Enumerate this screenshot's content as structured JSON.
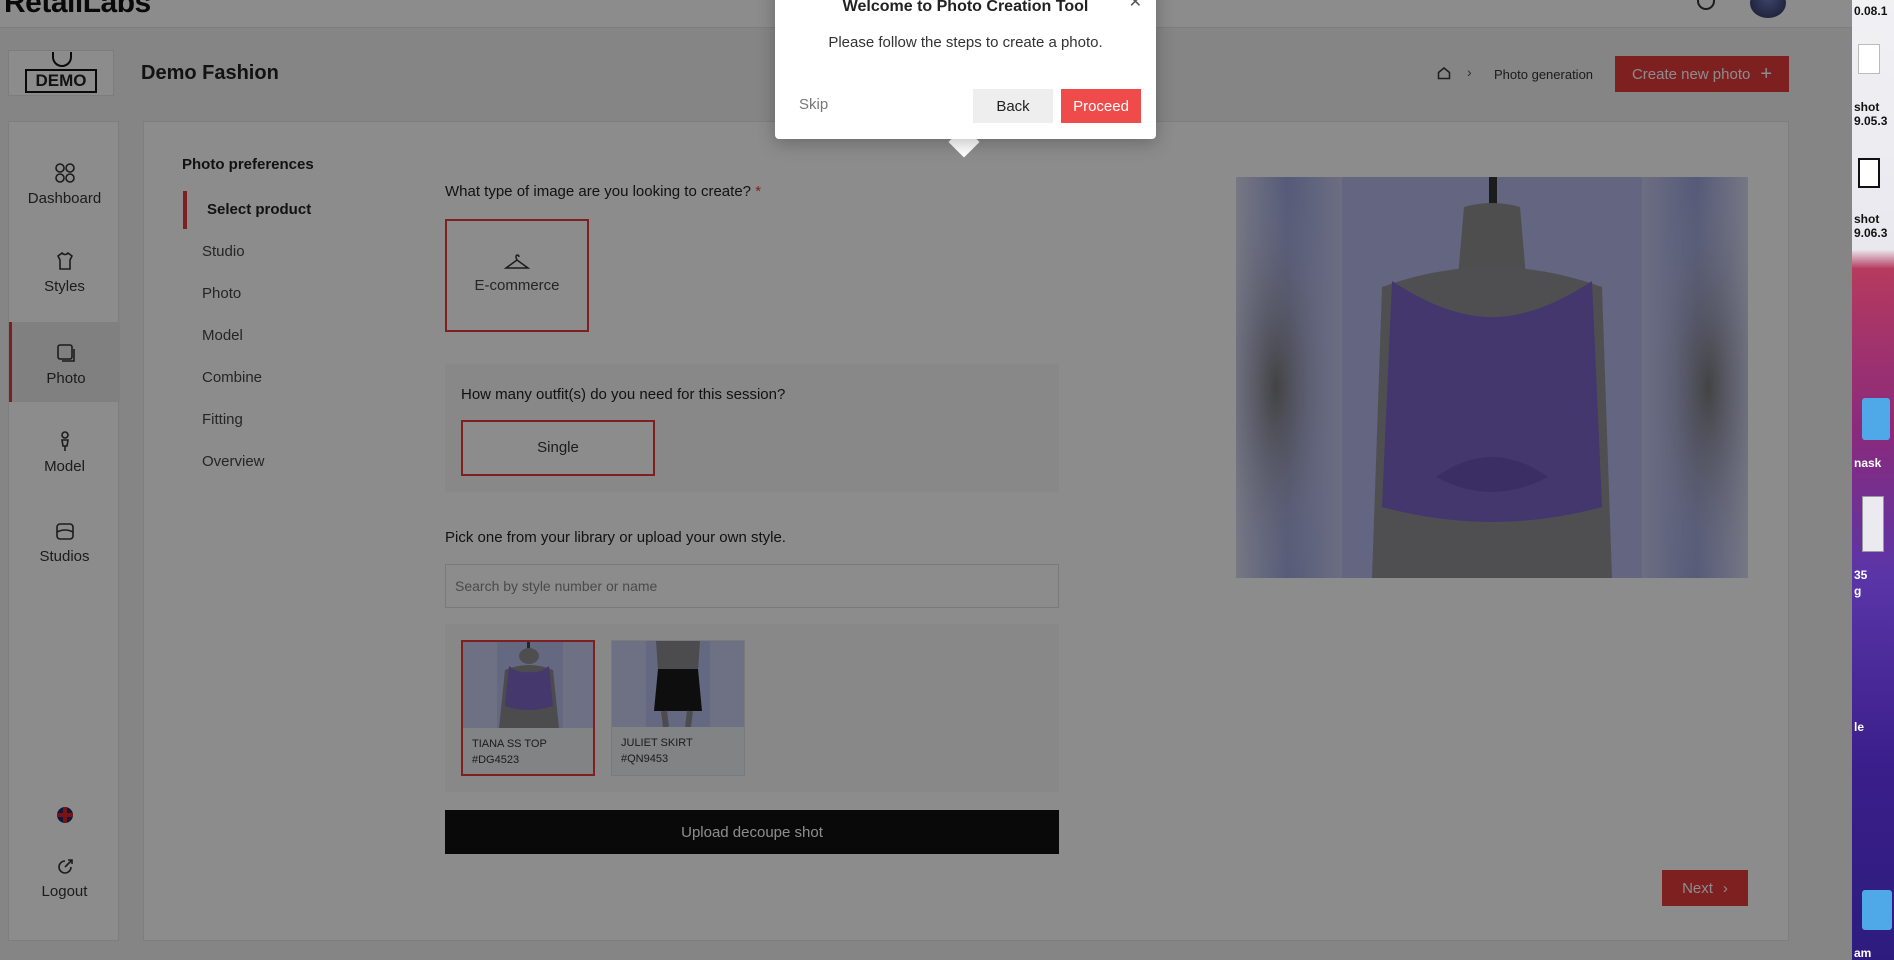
{
  "app": {
    "brand": "RetailLabs",
    "company": "Demo Fashion",
    "logo_text": "DEMO",
    "breadcrumb": {
      "current": "Photo generation"
    },
    "create_button": "Create new photo"
  },
  "sidebar": {
    "items": [
      {
        "label": "Dashboard",
        "icon": "grid-icon"
      },
      {
        "label": "Styles",
        "icon": "styles-icon"
      },
      {
        "label": "Photo",
        "icon": "photo-icon",
        "active": true
      },
      {
        "label": "Model",
        "icon": "model-icon"
      },
      {
        "label": "Studios",
        "icon": "studios-icon"
      }
    ],
    "logout": "Logout"
  },
  "wizard": {
    "title": "Photo preferences",
    "steps": [
      "Select product",
      "Studio",
      "Photo",
      "Model",
      "Combine",
      "Fitting",
      "Overview"
    ],
    "active_step": 0,
    "q_type": "What type of image are you looking to create?",
    "required_mark": "*",
    "type_option": "E-commerce",
    "q_outfits": "How many outfit(s) do you need for this session?",
    "outfit_option": "Single",
    "q_library": "Pick one from your library or upload your own style.",
    "search_placeholder": "Search by style number or name",
    "products": [
      {
        "name": "TIANA SS TOP",
        "code": "#DG4523",
        "selected": true
      },
      {
        "name": "JULIET SKIRT",
        "code": "#QN9453",
        "selected": false
      }
    ],
    "upload_button": "Upload decoupe shot",
    "next_button": "Next"
  },
  "tour": {
    "title": "Welcome to Photo Creation Tool",
    "body": "Please follow the steps to create a photo.",
    "skip": "Skip",
    "back": "Back",
    "proceed": "Proceed"
  },
  "desktop": {
    "labels": [
      "0.08.1",
      "shot",
      "9.05.3",
      "shot",
      "9.06.3",
      "nask",
      "35",
      "g",
      "le",
      "am"
    ]
  },
  "colors": {
    "accent": "#e63b3b",
    "dark_button": "#111111"
  }
}
